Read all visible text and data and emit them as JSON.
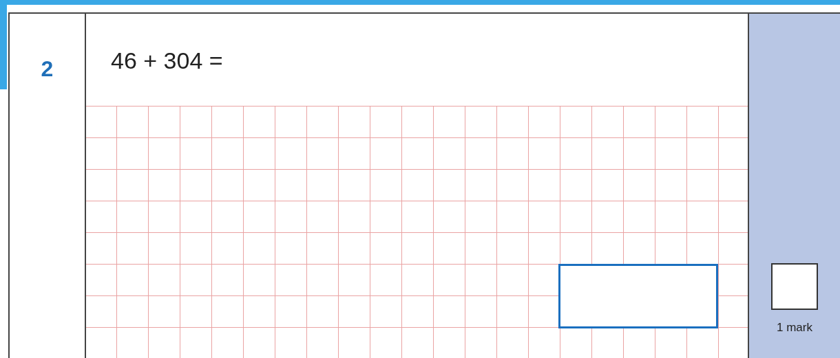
{
  "question": {
    "number": "2",
    "text": "46 + 304 ="
  },
  "marks": {
    "label": "1 mark"
  }
}
